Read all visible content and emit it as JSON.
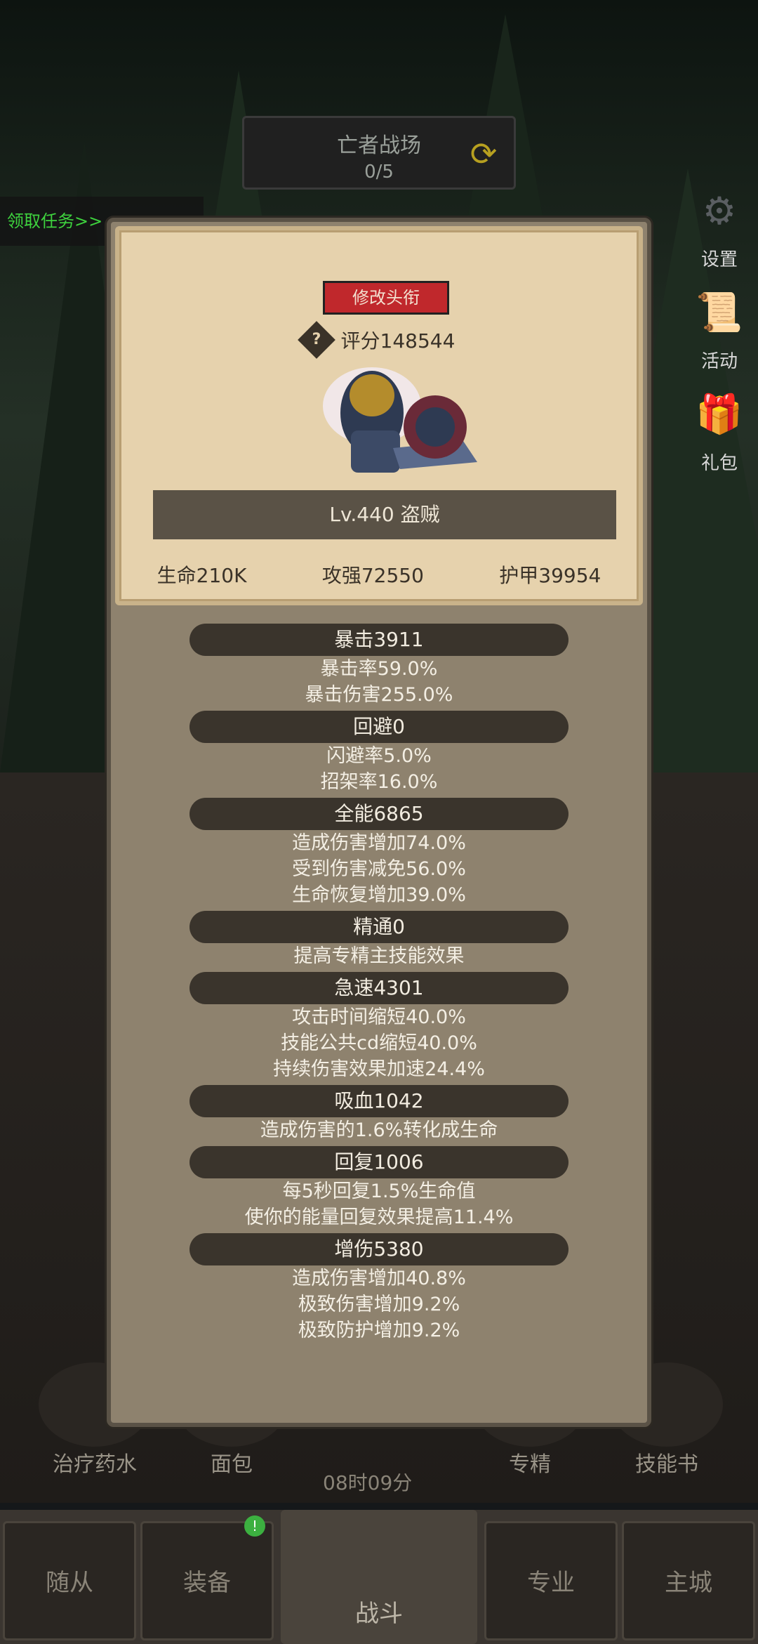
{
  "header": {
    "title": "亡者战场",
    "progress": "0/5"
  },
  "quest_link": "领取任务>>",
  "side_menu": [
    {
      "label": "设置",
      "icon": "gear-icon"
    },
    {
      "label": "活动",
      "icon": "scroll-icon"
    },
    {
      "label": "礼包",
      "icon": "gift-icon"
    }
  ],
  "popup": {
    "title_button": "修改头衔",
    "score": "评分148544",
    "level": "Lv.440 盗贼",
    "base_stats": [
      "生命210K",
      "攻强72550",
      "护甲39954"
    ],
    "groups": [
      {
        "head": "暴击3911",
        "lines": [
          "暴击率59.0%",
          "暴击伤害255.0%"
        ]
      },
      {
        "head": "回避0",
        "lines": [
          "闪避率5.0%",
          "招架率16.0%"
        ]
      },
      {
        "head": "全能6865",
        "lines": [
          "造成伤害增加74.0%",
          "受到伤害减免56.0%",
          "生命恢复增加39.0%"
        ]
      },
      {
        "head": "精通0",
        "lines": [
          "提高专精主技能效果"
        ]
      },
      {
        "head": "急速4301",
        "lines": [
          "攻击时间缩短40.0%",
          "技能公共cd缩短40.0%",
          "持续伤害效果加速24.4%"
        ]
      },
      {
        "head": "吸血1042",
        "lines": [
          "造成伤害的1.6%转化成生命"
        ]
      },
      {
        "head": "回复1006",
        "lines": [
          "每5秒回复1.5%生命值",
          "使你的能量回复效果提高11.4%"
        ]
      },
      {
        "head": "增伤5380",
        "lines": [
          "造成伤害增加40.8%",
          "极致伤害增加9.2%",
          "极致防护增加9.2%"
        ]
      }
    ]
  },
  "skills": [
    "治疗药水",
    "面包",
    "专精",
    "技能书"
  ],
  "timer": "08时09分",
  "nav": {
    "tabs": [
      "随从",
      "装备",
      "战斗",
      "专业",
      "主城"
    ],
    "equip_badge": "!"
  },
  "colors": {
    "title_button": "#c0282c",
    "quest_link": "#3ed23e",
    "stat_head_bg": "#3a342c"
  }
}
